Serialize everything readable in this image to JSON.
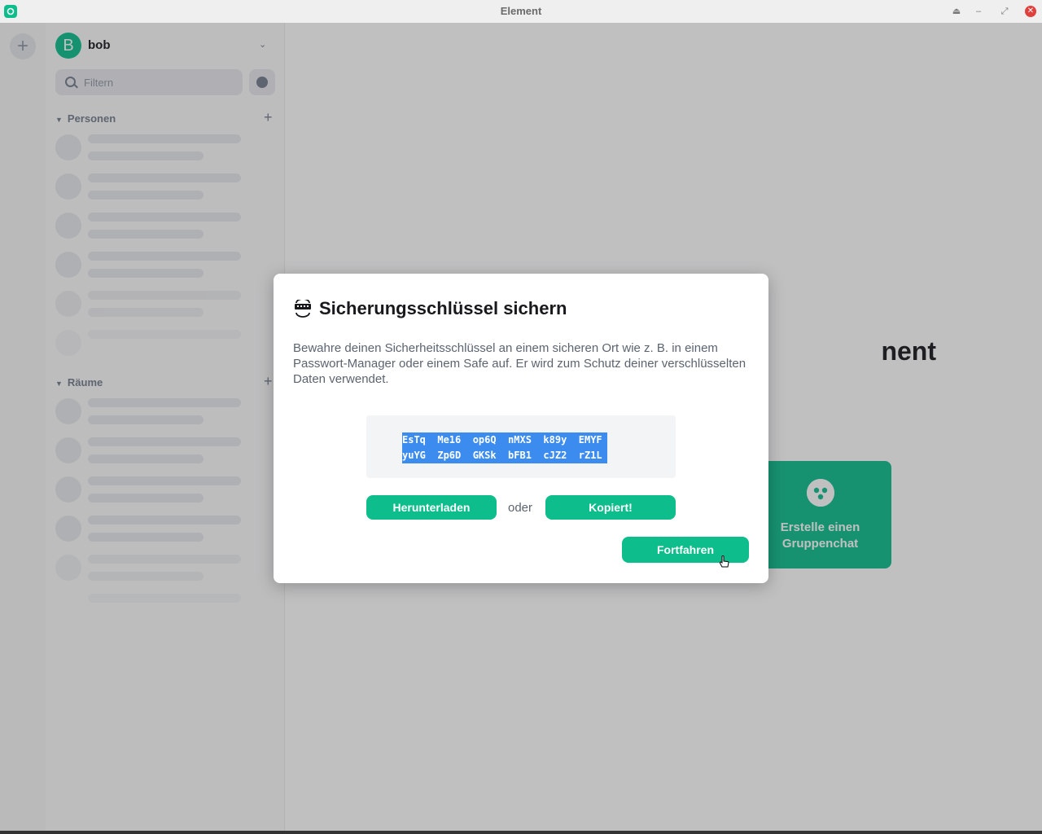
{
  "window": {
    "title": "Element"
  },
  "user": {
    "initial": "B",
    "name": "bob"
  },
  "filter": {
    "placeholder": "Filtern"
  },
  "sections": {
    "people": "Personen",
    "rooms": "Räume"
  },
  "main": {
    "welcome_partial": "nent",
    "group_chat_label": "Erstelle einen Gruppenchat"
  },
  "dialog": {
    "title": "Sicherungsschlüssel sichern",
    "description": "Bewahre deinen Sicherheitsschlüssel an einem sicheren Ort wie z. B. in einem Passwort-Manager oder einem Safe auf. Er wird zum Schutz deiner verschlüsselten Daten verwendet.",
    "key_line1": "EsTq  Me16  op6Q  nMXS  k89y  EMYF",
    "key_line2": "yuYG  Zp6D  GKSk  bFB1  cJZ2  rZ1L",
    "download_label": "Herunterladen",
    "or_label": "oder",
    "copy_label": "Kopiert!",
    "continue_label": "Fortfahren"
  },
  "colors": {
    "accent": "#0dbd8b",
    "selection": "#3c8cf0",
    "close": "#e0403d"
  }
}
